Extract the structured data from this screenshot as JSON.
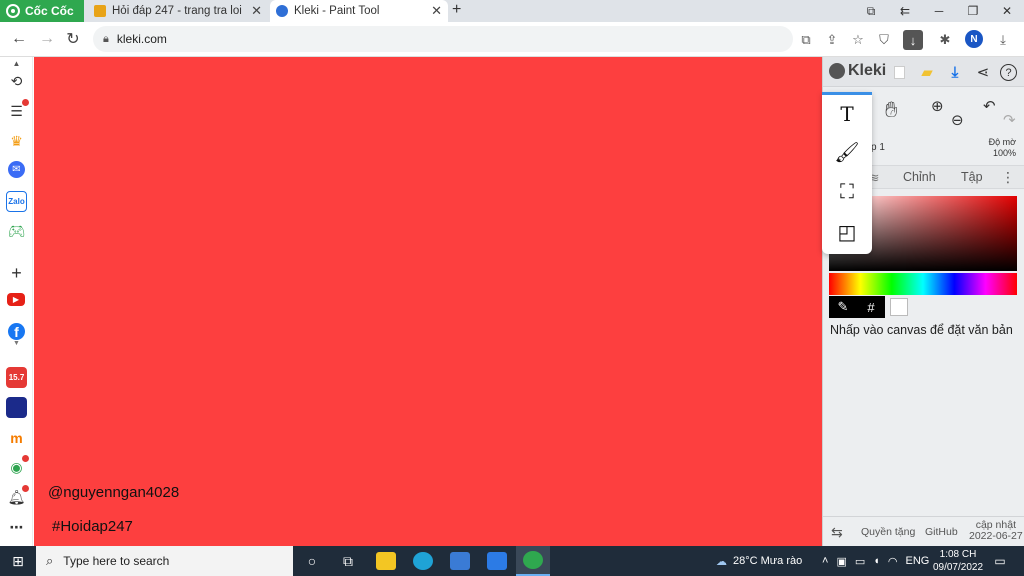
{
  "browser": {
    "brand": "Cốc Cốc",
    "tabs": [
      {
        "title": "Hỏi đáp 247 - trang tra loi"
      },
      {
        "title": "Kleki - Paint Tool"
      }
    ],
    "url": "kleki.com",
    "avatar_letter": "N",
    "new_tab": "+",
    "window_controls": {
      "minimize": "─",
      "maximize": "❐",
      "close": "✕"
    }
  },
  "sidebar": {
    "icons": [
      "history-icon",
      "news-icon",
      "crown-icon",
      "messenger-icon",
      "zalo-icon",
      "game-icon",
      "add-icon",
      "youtube-icon",
      "facebook-icon",
      "shop-icon",
      "game2-icon",
      "mart-icon",
      "chat-icon",
      "bell-icon",
      "more-icon"
    ]
  },
  "canvas": {
    "background": "#fd3f3f",
    "watermark_user": "@nguyenngan4028",
    "watermark_tag": "#Hoidap247"
  },
  "kleki": {
    "logo": "Kleki",
    "layer_name": "p 1",
    "opacity_label": "Độ mờ",
    "opacity_value": "100%",
    "tabs": [
      "Chỉnh",
      "Tập"
    ],
    "hint": "Nhấp vào canvas để đặt văn bản",
    "hex_symbol": "#",
    "tools": [
      "text-tool",
      "brush-tool",
      "fill-tool",
      "shape-tool"
    ],
    "text_tool_glyph": "T",
    "footer": {
      "privacy": "Quyền tặng",
      "github": "GitHub",
      "updated_label": "cập nhật",
      "updated_date": "2022-06-27"
    }
  },
  "taskbar": {
    "search_placeholder": "Type here to search",
    "weather": "28°C  Mưa rào",
    "lang": "ENG",
    "time": "1:08 CH",
    "date": "09/07/2022"
  }
}
